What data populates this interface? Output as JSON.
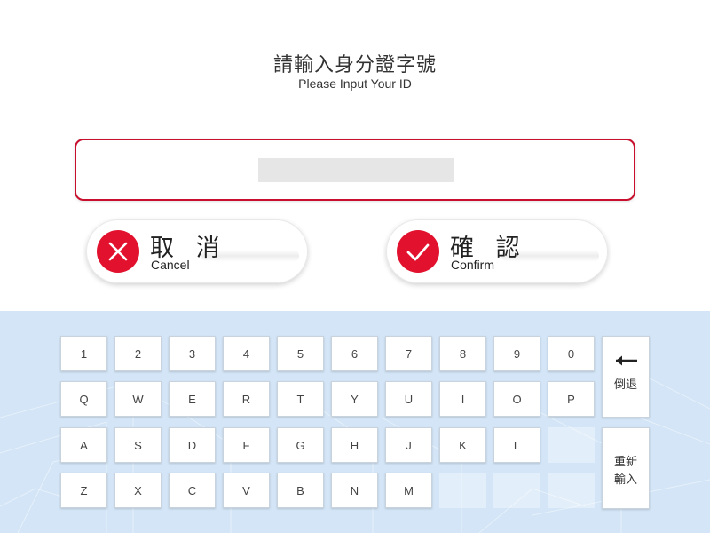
{
  "header": {
    "title_zh": "請輸入身分證字號",
    "title_en": "Please Input Your ID"
  },
  "id_input": {
    "value": "",
    "border_color": "#c8102e"
  },
  "actions": {
    "cancel": {
      "label_zh": "取 消",
      "label_en": "Cancel",
      "icon": "close-icon",
      "color": "#e2122f"
    },
    "confirm": {
      "label_zh": "確 認",
      "label_en": "Confirm",
      "icon": "check-icon",
      "color": "#e2122f"
    }
  },
  "keyboard": {
    "background": "#d3e5f6",
    "rows": [
      [
        "1",
        "2",
        "3",
        "4",
        "5",
        "6",
        "7",
        "8",
        "9",
        "0"
      ],
      [
        "Q",
        "W",
        "E",
        "R",
        "T",
        "Y",
        "U",
        "I",
        "O",
        "P"
      ],
      [
        "A",
        "S",
        "D",
        "F",
        "G",
        "H",
        "J",
        "K",
        "L"
      ],
      [
        "Z",
        "X",
        "C",
        "V",
        "B",
        "N",
        "M"
      ]
    ],
    "backspace": {
      "label": "倒退",
      "icon": "arrow-left-icon"
    },
    "reset": {
      "label_line1": "重新",
      "label_line2": "輸入"
    }
  }
}
